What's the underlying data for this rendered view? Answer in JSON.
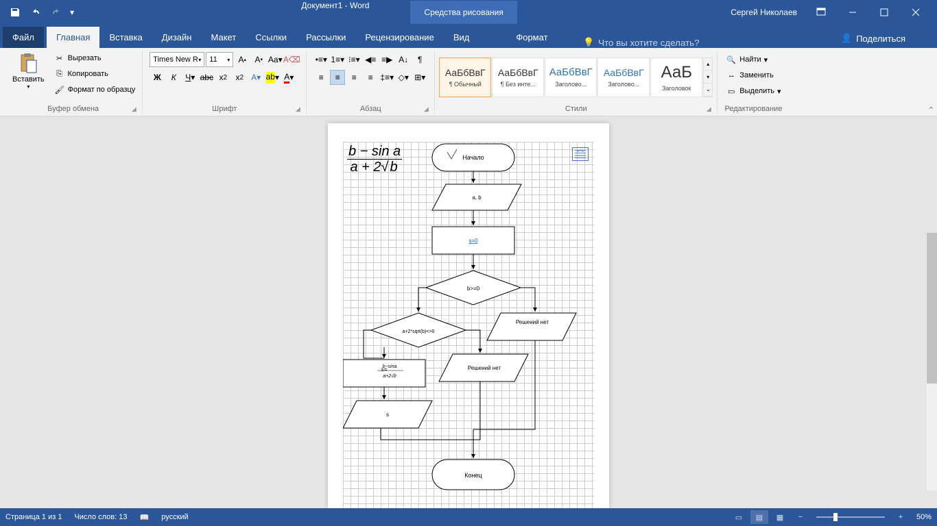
{
  "titlebar": {
    "doc_title": "Документ1 - Word",
    "tools_title": "Средства рисования",
    "user_name": "Сергей Николаев"
  },
  "tabs": {
    "file": "Файл",
    "home": "Главная",
    "insert": "Вставка",
    "design": "Дизайн",
    "layout": "Макет",
    "references": "Ссылки",
    "mailings": "Рассылки",
    "review": "Рецензирование",
    "view": "Вид",
    "format": "Формат",
    "tellme_placeholder": "Что вы хотите сделать?",
    "share": "Поделиться"
  },
  "ribbon": {
    "paste": "Вставить",
    "cut": "Вырезать",
    "copy": "Копировать",
    "format_painter": "Формат по образцу",
    "clipboard_group": "Буфер обмена",
    "font_name": "Times New R",
    "font_size": "11",
    "font_group": "Шрифт",
    "para_group": "Абзац",
    "styles_group": "Стили",
    "style1": "¶ Обычный",
    "style2": "¶ Без инте...",
    "style3": "Заголово...",
    "style4": "Заголово...",
    "style5": "Заголовок",
    "style_preview": "АаБбВвГ",
    "style_preview_title": "АаБ",
    "find": "Найти",
    "replace": "Заменить",
    "select": "Выделить",
    "editing_group": "Редактирование"
  },
  "flowchart": {
    "start": "Начало",
    "input": "a, b",
    "process1": "s=0",
    "decision1": "b>=0",
    "decision2": "a+2*sqrt(b)<>0",
    "no_solution": "Решений нет",
    "no_solution2": "Решений нет",
    "formula_num": "b−sina",
    "formula_den": "a+2√b",
    "output": "s",
    "end": "Конец"
  },
  "equation": {
    "num": "b − sin a",
    "den_a": "a + 2",
    "den_b": "b"
  },
  "statusbar": {
    "page": "Страница 1 из 1",
    "words": "Число слов: 13",
    "lang": "русский",
    "zoom": "50%"
  }
}
